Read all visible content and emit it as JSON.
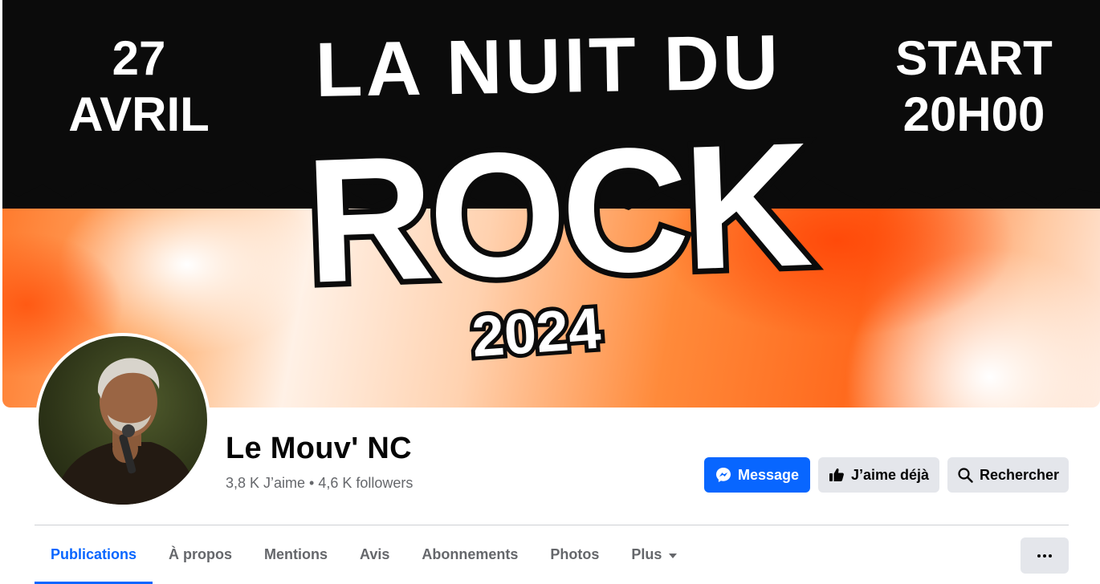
{
  "cover": {
    "date_day": "27",
    "date_month": "AVRIL",
    "title_line1": "LA NUIT DU",
    "title_line2": "ROCK",
    "year": "2024",
    "start_label": "START",
    "start_time": "20H00"
  },
  "page": {
    "name": "Le Mouv' NC",
    "stats": "3,8 K J’aime • 4,6 K followers"
  },
  "actions": {
    "message": "Message",
    "like": "J’aime déjà",
    "search": "Rechercher"
  },
  "tabs": [
    {
      "label": "Publications"
    },
    {
      "label": "À propos"
    },
    {
      "label": "Mentions"
    },
    {
      "label": "Avis"
    },
    {
      "label": "Abonnements"
    },
    {
      "label": "Photos"
    },
    {
      "label": "Plus"
    }
  ],
  "colors": {
    "accent": "#0866ff",
    "secondary_button": "#e4e6eb",
    "muted_text": "#65676b"
  },
  "icons": {
    "message": "messenger-icon",
    "like": "thumbs-up-icon",
    "search": "search-icon",
    "plus": "caret-down-icon",
    "more": "more-dots-icon"
  }
}
